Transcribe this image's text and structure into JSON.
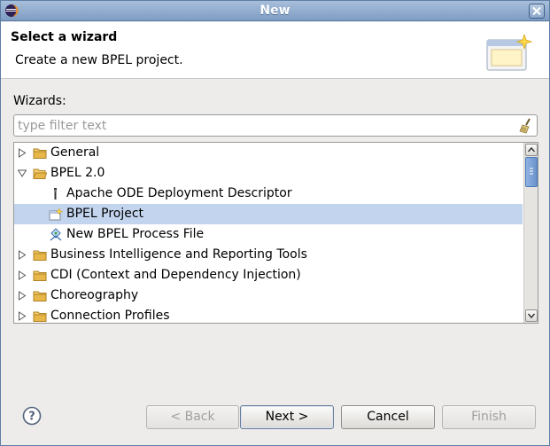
{
  "window": {
    "title": "New"
  },
  "banner": {
    "heading": "Select a wizard",
    "description": "Create a new BPEL project."
  },
  "wizards_label": "Wizards:",
  "filter": {
    "value": "",
    "placeholder": "type filter text"
  },
  "tree": {
    "items": [
      {
        "label": "General",
        "level": 0,
        "expanded": false,
        "icon": "folder-icon"
      },
      {
        "label": "BPEL 2.0",
        "level": 0,
        "expanded": true,
        "icon": "folder-icon"
      },
      {
        "label": "Apache ODE Deployment Descriptor",
        "level": 1,
        "icon": "ode-descriptor-icon"
      },
      {
        "label": "BPEL Project",
        "level": 1,
        "icon": "bpel-project-icon",
        "selected": true
      },
      {
        "label": "New BPEL Process File",
        "level": 1,
        "icon": "bpel-process-icon"
      },
      {
        "label": "Business Intelligence and Reporting Tools",
        "level": 0,
        "expanded": false,
        "icon": "folder-icon"
      },
      {
        "label": "CDI (Context and Dependency Injection)",
        "level": 0,
        "expanded": false,
        "icon": "folder-icon"
      },
      {
        "label": "Choreography",
        "level": 0,
        "expanded": false,
        "icon": "folder-icon"
      },
      {
        "label": "Connection Profiles",
        "level": 0,
        "expanded": false,
        "icon": "folder-icon"
      }
    ]
  },
  "buttons": {
    "back": "< Back",
    "next": "Next >",
    "cancel": "Cancel",
    "finish": "Finish"
  },
  "colors": {
    "selection": "#c3d5ee",
    "titlebar": "#7e9cc3",
    "folder": "#e8b74a"
  }
}
